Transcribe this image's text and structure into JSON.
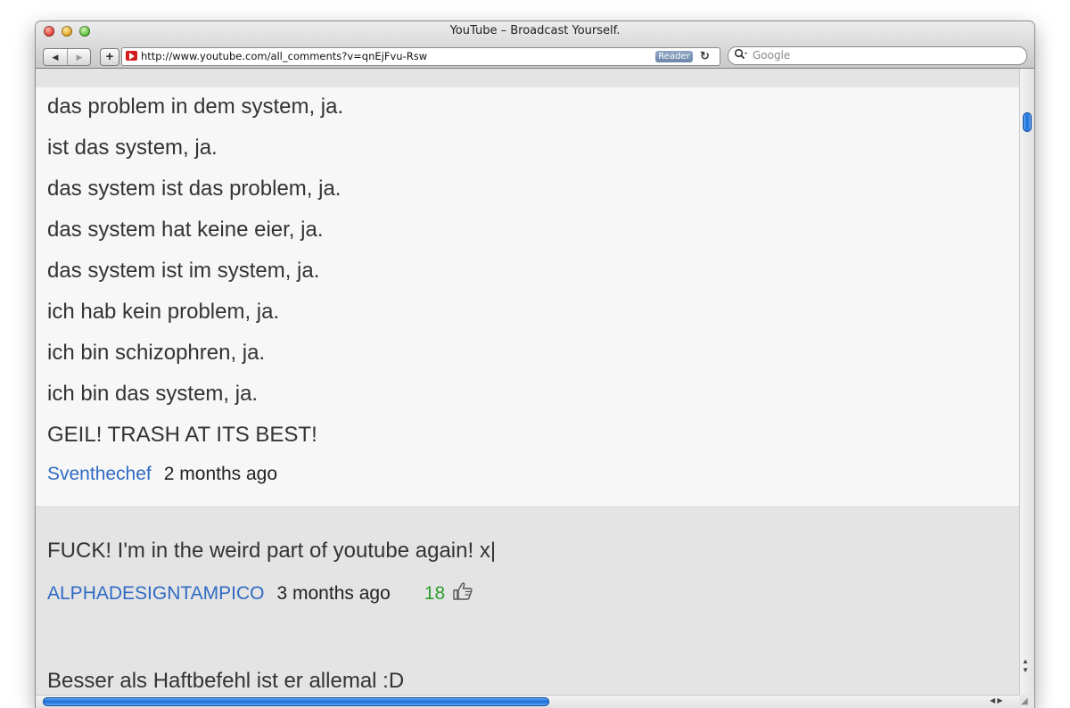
{
  "window": {
    "title": "YouTube – Broadcast Yourself."
  },
  "toolbar": {
    "back_glyph": "◀",
    "forward_glyph": "▶",
    "add_glyph": "+",
    "url": "http://www.youtube.com/all_comments?v=qnEjFvu-Rsw",
    "reader_label": "Reader",
    "reload_glyph": "↻",
    "search_placeholder": "Google"
  },
  "comments": [
    {
      "lines": [
        "das problem in dem system, ja.",
        "ist das system, ja.",
        "das system ist das problem, ja.",
        "das system hat keine eier, ja.",
        "das system ist im system, ja.",
        "ich hab kein problem, ja.",
        "ich bin schizophren, ja.",
        "ich bin das system, ja.",
        "GEIL! TRASH AT ITS BEST!"
      ],
      "author": "Sventhechef",
      "time": "2 months ago",
      "highlighted": true
    },
    {
      "lines": [
        "FUCK! I'm in the weird part of youtube again! x|"
      ],
      "author": "ALPHADESIGNTAMPICO",
      "time": "3 months ago",
      "likes": "18"
    },
    {
      "lines": [
        "Besser als Haftbefehl ist er allemal :D"
      ]
    }
  ],
  "colors": {
    "author_link": "#2f6bc4",
    "likes_green": "#2e9e2e",
    "scroll_thumb": "#1c6fd6"
  },
  "icons": [
    "thumbs-up-icon",
    "search-icon",
    "youtube-favicon",
    "reload-icon"
  ]
}
